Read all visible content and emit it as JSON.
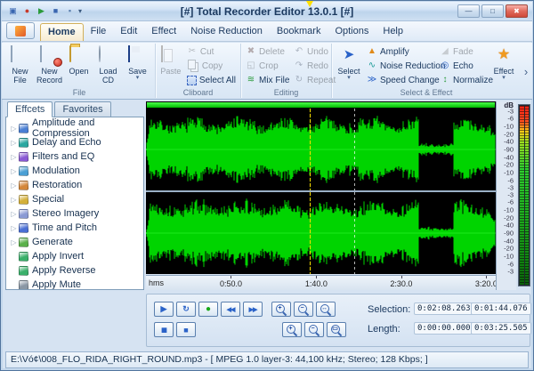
{
  "window": {
    "title": "[#] Total Recorder Editor 13.0.1 [#]",
    "controls": {
      "minimize": "—",
      "maximize": "□",
      "close": "✖"
    }
  },
  "qat": {
    "icons": [
      {
        "name": "app-icon",
        "glyph": "▣",
        "color": "#3a66b0"
      },
      {
        "name": "record-icon",
        "glyph": "●",
        "color": "#c83a2a"
      },
      {
        "name": "play-icon",
        "glyph": "▶",
        "color": "#2a9a3a"
      },
      {
        "name": "stop-icon",
        "glyph": "■",
        "color": "#3a66b0"
      },
      {
        "name": "save-icon",
        "glyph": "▪",
        "color": "#5a7fae"
      }
    ],
    "caret": "▾"
  },
  "tabs": [
    {
      "label": "Home",
      "active": true
    },
    {
      "label": "File"
    },
    {
      "label": "Edit"
    },
    {
      "label": "Effect"
    },
    {
      "label": "Noise Reduction"
    },
    {
      "label": "Bookmark"
    },
    {
      "label": "Options"
    },
    {
      "label": "Help"
    }
  ],
  "ribbon": {
    "file": {
      "label": "File",
      "new_file": "New File",
      "new_record": "New Record",
      "open": "Open",
      "load_cd": "Load CD",
      "save": "Save"
    },
    "clipboard": {
      "label": "Cliboard",
      "paste": "Paste",
      "cut": "Cut",
      "copy": "Copy",
      "select_all": "Select All"
    },
    "editing": {
      "label": "Editing",
      "delete": "Delete",
      "crop": "Crop",
      "undo": "Undo",
      "redo": "Redo",
      "mix_file": "Mix File",
      "repeat": "Repeat"
    },
    "select_effect": {
      "label": "Select & Effect",
      "select": "Select",
      "amplify": "Amplify",
      "noise_reduction": "Noise Reduction",
      "speed_change": "Speed Change",
      "fade": "Fade",
      "echo": "Echo",
      "normalize": "Normalize",
      "effect": "Effect"
    }
  },
  "glyphs": {
    "expand_arrow": "▷",
    "caret_down": "▾",
    "scroll_right": "›",
    "cut": "✂",
    "delete": "✖",
    "crop": "◱",
    "undo": "↶",
    "redo": "↷",
    "mix_file": "≋",
    "repeat": "↻",
    "amplify": "▲",
    "noise_reduction": "∿",
    "speed_change": "≫",
    "fade": "◢",
    "echo": "◎",
    "normalize": "↕",
    "select_pointer": "➤",
    "effect_star": "★"
  },
  "sidebar": {
    "tabs": [
      {
        "label": "Effcets",
        "active": true
      },
      {
        "label": "Favorites",
        "active": false
      }
    ],
    "items": [
      {
        "label": "Amplitude and Compression",
        "icon": "compressor-icon",
        "color": "#4a7fd4",
        "arrow": true
      },
      {
        "label": "Delay and Echo",
        "icon": "delay-echo-icon",
        "color": "#2aa7a0",
        "arrow": true
      },
      {
        "label": "Filters and EQ",
        "icon": "filters-eq-icon",
        "color": "#8a5ad4",
        "arrow": true
      },
      {
        "label": "Modulation",
        "icon": "modulation-icon",
        "color": "#4a9fd4",
        "arrow": true
      },
      {
        "label": "Restoration",
        "icon": "restoration-icon",
        "color": "#d4873a",
        "arrow": true
      },
      {
        "label": "Special",
        "icon": "special-icon",
        "color": "#d4b03a",
        "arrow": true
      },
      {
        "label": "Stereo Imagery",
        "icon": "stereo-imagery-icon",
        "color": "#8a9ad4",
        "arrow": true
      },
      {
        "label": "Time and Pitch",
        "icon": "time-pitch-icon",
        "color": "#4a6fd4",
        "arrow": true
      },
      {
        "label": "Generate",
        "icon": "generate-icon",
        "color": "#5ab04a",
        "arrow": true
      },
      {
        "label": "Apply Invert",
        "icon": "apply-invert-icon",
        "color": "#3ab06a",
        "arrow": false
      },
      {
        "label": "Apply Reverse",
        "icon": "apply-reverse-icon",
        "color": "#3ab06a",
        "arrow": false
      },
      {
        "label": "Apply Mute",
        "icon": "apply-mute-icon",
        "color": "#8a97a5",
        "arrow": false
      }
    ]
  },
  "waveform": {
    "db_unit": "dB",
    "db_labels": [
      "-3",
      "-6",
      "-10",
      "-20",
      "-40",
      "-90",
      "-40",
      "-20",
      "-10",
      "-6",
      "-3"
    ],
    "ruler_unit": "hms",
    "ticks": [
      {
        "label": "0:50.0",
        "pct": 24.3
      },
      {
        "label": "1:40.0",
        "pct": 48.7
      },
      {
        "label": "2:30.0",
        "pct": 73.0
      },
      {
        "label": "3:20.0",
        "pct": 97.3
      }
    ],
    "cursor_pct": 46.7,
    "selection_edge_pct": 59.5
  },
  "transport": {
    "icons": {
      "play": "▶",
      "loop": "↻",
      "record": "●",
      "rewind": "◀◀",
      "forward": "▶▶",
      "pause": "▮▮",
      "stop": "■",
      "zoom_in": "+",
      "zoom_out": "−",
      "zoom_sel": "↔",
      "zoom_vin": "+",
      "zoom_vout": "−",
      "zoom_all": "▭"
    }
  },
  "info": {
    "selection_label": "Selection:",
    "length_label": "Length:",
    "selection": [
      "0:02:08.263",
      "0:01:44.076"
    ],
    "length": [
      "0:00:00.000",
      "0:03:25.505"
    ]
  },
  "statusbar": {
    "text": "E:\\Vó¢\\008_FLO_RIDA_RIGHT_ROUND.mp3 - [ MPEG 1.0 layer-3: 44,100 kHz; Stereo; 128 Kbps; ]"
  },
  "colors": {
    "waveform": "#00d400",
    "waveform_bg": "#000000",
    "cursor": "#ffe000",
    "meter_red": "#ff2014",
    "meter_green": "#30d030",
    "titlebar": "#cfe0f2",
    "accent_border": "#7f9db9"
  }
}
